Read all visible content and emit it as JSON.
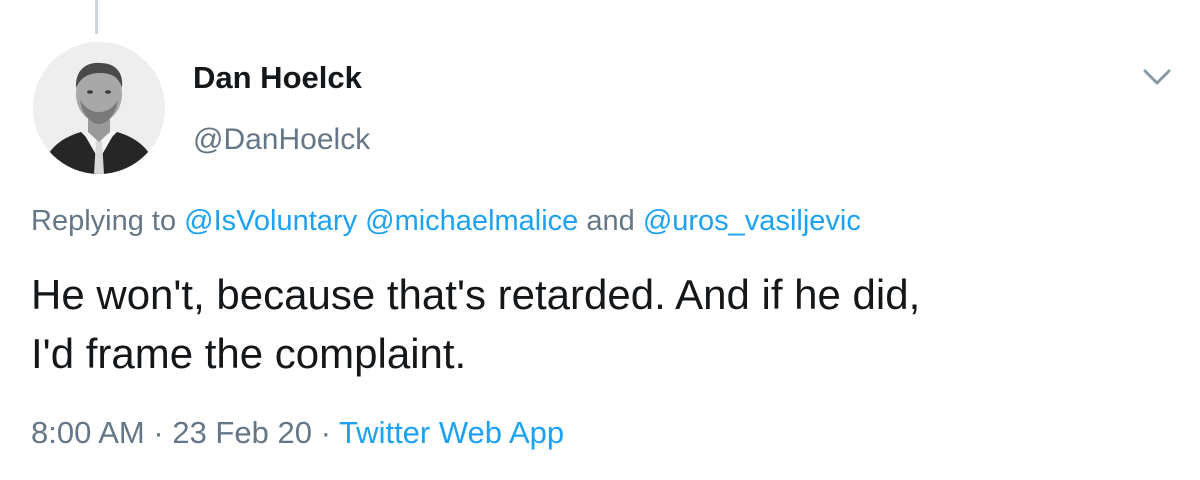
{
  "tweet": {
    "author": {
      "display_name": "Dan Hoelck",
      "handle": "@DanHoelck",
      "avatar_icon": "profile-photo"
    },
    "reply": {
      "prefix": "Replying to",
      "mentions": [
        "@IsVoluntary",
        "@michaelmalice",
        "@uros_vasiljevic"
      ],
      "conjunction": "and"
    },
    "text_line1": "He won't, because that's retarded. And if he did,",
    "text_line2": "I'd frame the complaint.",
    "time": "8:00 AM",
    "separator": "·",
    "date": "23 Feb 20",
    "source": "Twitter Web App",
    "menu_icon": "chevron-down-icon"
  },
  "colors": {
    "text_primary": "#14171a",
    "text_secondary": "#657786",
    "link": "#1da1f2",
    "thread_line": "#ccd6dd"
  }
}
